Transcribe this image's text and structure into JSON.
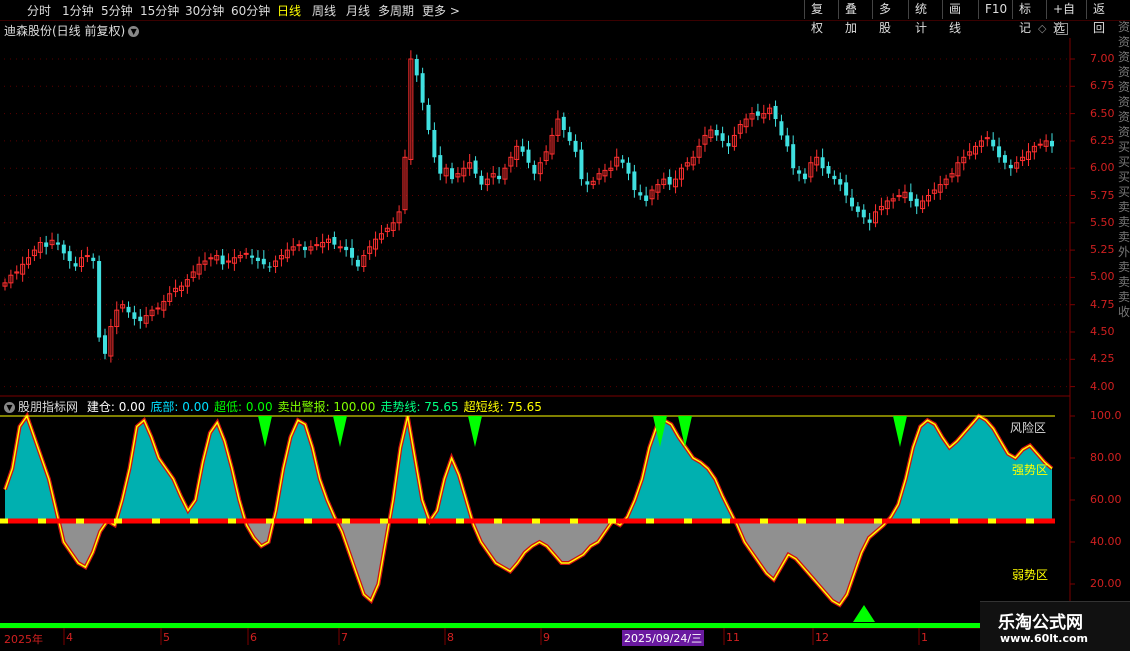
{
  "toolbar": {
    "periods": [
      "分时",
      "1分钟",
      "5分钟",
      "15分钟",
      "30分钟",
      "60分钟",
      "日线",
      "周线",
      "月线",
      "多周期",
      "更多 >"
    ],
    "active_period": "日线",
    "right_buttons": [
      "复权",
      "叠加",
      "多股",
      "统计",
      "画线",
      "F10",
      "标记",
      "+自选",
      "返回"
    ]
  },
  "chart_title": "迪森股份(日线 前复权)",
  "price_axis": [
    "7.00",
    "6.75",
    "6.50",
    "6.25",
    "6.00",
    "5.75",
    "5.50",
    "5.25",
    "5.00",
    "4.75",
    "4.50",
    "4.25",
    "4.00"
  ],
  "indicator": {
    "name": "股朋指标网",
    "items": [
      {
        "label": "建仓:",
        "value": "0.00",
        "color": "#ffffff"
      },
      {
        "label": "底部:",
        "value": "0.00",
        "color": "#00e0ff"
      },
      {
        "label": "超低:",
        "value": "0.00",
        "color": "#00ff00"
      },
      {
        "label": "卖出警报:",
        "value": "100.00",
        "color": "#80ff00"
      },
      {
        "label": "走势线:",
        "value": "75.65",
        "color": "#00ff80"
      },
      {
        "label": "超短线:",
        "value": "75.65",
        "color": "#ffff00"
      }
    ],
    "axis": [
      "100.0",
      "80.00",
      "60.00",
      "40.00",
      "20.00"
    ],
    "zones": {
      "risk": "风险区",
      "strong": "强势区",
      "weak": "弱势区"
    }
  },
  "dates": [
    "2025年",
    "4",
    "5",
    "6",
    "7",
    "8",
    "9",
    "11",
    "12",
    "1"
  ],
  "selected_date": "2025/09/24/三",
  "watermark": {
    "title": "乐淘公式网",
    "url": "www.60lt.com"
  },
  "sidebar_text": "资资资资资资资资买买买买卖卖卖外卖卖卖收",
  "colors": {
    "up": "#ff3030",
    "down": "#40e0e0",
    "bg": "#000000",
    "axis": "#d02020"
  },
  "chart_data": {
    "type": "candlestick",
    "ylim": [
      3.85,
      7.2
    ],
    "close": [
      4.95,
      5.02,
      5.05,
      5.12,
      5.18,
      5.25,
      5.32,
      5.28,
      5.34,
      5.3,
      5.22,
      5.15,
      5.1,
      5.18,
      5.2,
      5.15,
      4.45,
      4.3,
      4.55,
      4.7,
      4.75,
      4.68,
      4.62,
      4.6,
      4.65,
      4.7,
      4.72,
      4.78,
      4.85,
      4.9,
      4.92,
      4.98,
      5.05,
      5.12,
      5.15,
      5.18,
      5.2,
      5.12,
      5.15,
      5.18,
      5.2,
      5.22,
      5.18,
      5.15,
      5.12,
      5.1,
      5.15,
      5.2,
      5.25,
      5.28,
      5.3,
      5.25,
      5.28,
      5.3,
      5.32,
      5.35,
      5.3,
      5.28,
      5.25,
      5.18,
      5.1,
      5.2,
      5.28,
      5.35,
      5.4,
      5.45,
      5.5,
      5.6,
      6.1,
      7.0,
      6.85,
      6.6,
      6.35,
      6.1,
      5.95,
      6.0,
      5.9,
      5.95,
      6.0,
      6.05,
      5.95,
      5.85,
      5.9,
      5.95,
      5.9,
      6.0,
      6.1,
      6.2,
      6.15,
      6.05,
      5.95,
      6.05,
      6.15,
      6.3,
      6.45,
      6.35,
      6.25,
      6.15,
      5.9,
      5.85,
      5.88,
      5.95,
      5.98,
      6.0,
      6.1,
      6.05,
      5.95,
      5.8,
      5.75,
      5.7,
      5.8,
      5.85,
      5.9,
      5.85,
      5.9,
      6.0,
      6.05,
      6.1,
      6.2,
      6.3,
      6.35,
      6.3,
      6.25,
      6.2,
      6.3,
      6.4,
      6.45,
      6.5,
      6.48,
      6.5,
      6.55,
      6.45,
      6.3,
      6.2,
      6.0,
      5.95,
      5.9,
      6.05,
      6.1,
      6.0,
      5.95,
      5.9,
      5.85,
      5.75,
      5.65,
      5.6,
      5.55,
      5.5,
      5.6,
      5.65,
      5.7,
      5.72,
      5.75,
      5.78,
      5.7,
      5.65,
      5.7,
      5.75,
      5.8,
      5.85,
      5.9,
      5.95,
      6.05,
      6.1,
      6.15,
      6.2,
      6.25,
      6.28,
      6.2,
      6.1,
      6.05,
      6.0,
      6.05,
      6.1,
      6.15,
      6.2,
      6.22,
      6.25,
      6.2
    ]
  }
}
